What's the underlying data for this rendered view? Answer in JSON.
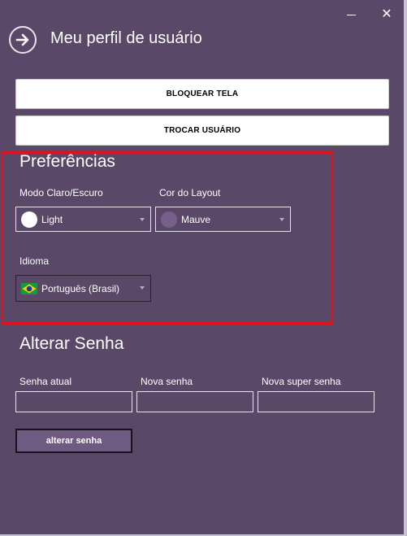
{
  "window": {
    "minimize_icon": "minimize-icon",
    "close_icon": "close-icon",
    "close_glyph": "✕"
  },
  "header": {
    "back_icon": "arrow-right-circle-icon",
    "title": "Meu perfil de usuário"
  },
  "actions": {
    "lock_label": "BLOQUEAR TELA",
    "switch_user_label": "TROCAR USUÁRIO"
  },
  "preferences": {
    "title": "Preferências",
    "theme": {
      "label": "Modo Claro/Escuro",
      "value": "Light",
      "swatch_color": "#ffffff"
    },
    "layout_color": {
      "label": "Cor do Layout",
      "value": "Mauve",
      "swatch_color": "#76608a"
    },
    "language": {
      "label": "Idioma",
      "value": "Português (Brasil)",
      "flag_icon": "brazil-flag-icon"
    }
  },
  "password": {
    "title": "Alterar Senha",
    "current_label": "Senha atual",
    "current_value": "",
    "new_label": "Nova senha",
    "new_value": "",
    "super_label": "Nova super senha",
    "super_value": "",
    "submit_label": "alterar senha"
  },
  "colors": {
    "background": "#594867",
    "highlight_border": "#e0101c",
    "accent": "#76608a",
    "button_dark": "#6f5a82"
  }
}
